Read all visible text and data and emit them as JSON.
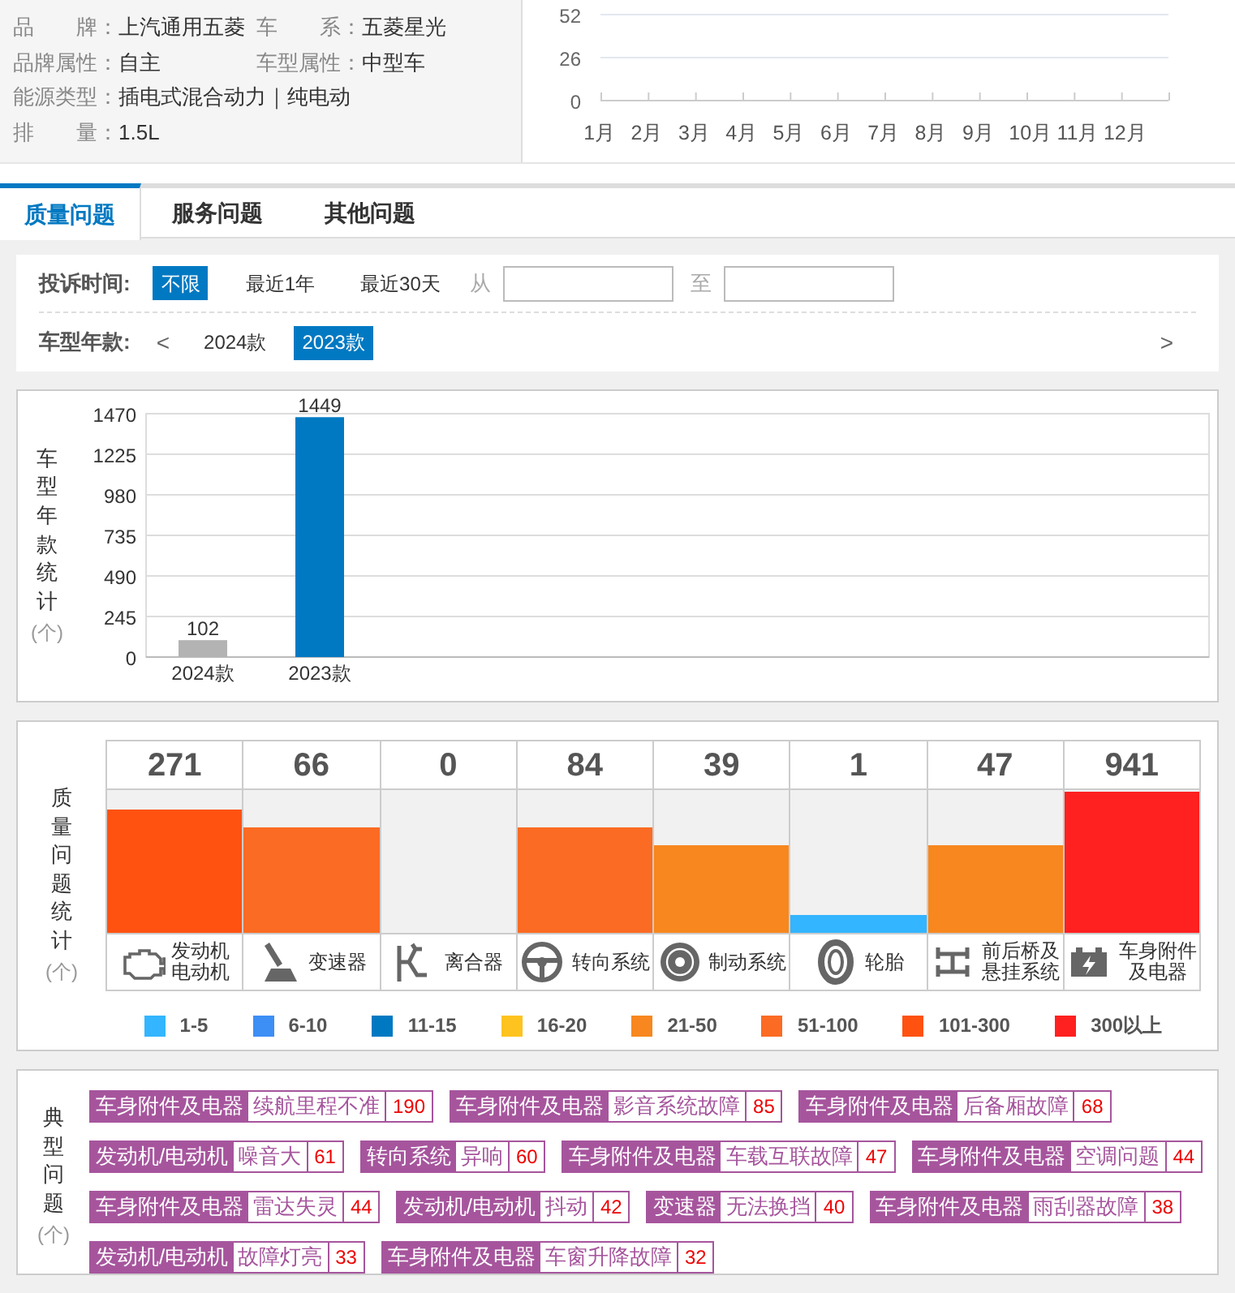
{
  "info": [
    [
      {
        "label": "品　　牌：",
        "value": "上汽通用五菱"
      },
      {
        "label": "车　　系：",
        "value": "五菱星光"
      }
    ],
    [
      {
        "label": "品牌属性：",
        "value": "自主"
      },
      {
        "label": "车型属性：",
        "value": "中型车"
      }
    ],
    [
      {
        "label": "能源类型：",
        "value": "插电式混合动力｜纯电动"
      }
    ],
    [
      {
        "label": "排　　量：",
        "value": "1.5L"
      }
    ]
  ],
  "trend_chart": {
    "chart_data": {
      "type": "line",
      "categories": [
        "1月",
        "2月",
        "3月",
        "4月",
        "5月",
        "6月",
        "7月",
        "8月",
        "9月",
        "10月",
        "11月",
        "12月"
      ],
      "ylim": [
        0,
        52
      ],
      "yticks": [
        0,
        26,
        52
      ]
    }
  },
  "tabs": [
    {
      "label": "质量问题",
      "selected": true
    },
    {
      "label": "服务问题",
      "selected": false
    },
    {
      "label": "其他问题",
      "selected": false
    }
  ],
  "filters": {
    "time_label": "投诉时间:",
    "time_options": [
      {
        "label": "不限",
        "selected": true
      },
      {
        "label": "最近1年",
        "selected": false
      },
      {
        "label": "最近30天",
        "selected": false
      }
    ],
    "from_label": "从",
    "to_label": "至",
    "year_label": "车型年款:",
    "prev": "<",
    "next": ">",
    "years": [
      {
        "label": "2024款",
        "selected": false
      },
      {
        "label": "2023款",
        "selected": true
      }
    ]
  },
  "year_chart": {
    "side_label": "车型年款统计",
    "unit": "(个)",
    "chart_data": {
      "type": "bar",
      "categories": [
        "2024款",
        "2023款"
      ],
      "series": [
        {
          "values": [
            102,
            1449
          ]
        }
      ],
      "ylim": [
        0,
        1470
      ],
      "grid": true,
      "yticks": [
        0,
        245,
        490,
        735,
        980,
        1225,
        1470
      ],
      "data_labels": true
    }
  },
  "quality": {
    "side_label": "质量问题统计",
    "unit": "(个)",
    "items": [
      {
        "count": "271",
        "label": "发动机电动机",
        "level": 0.875,
        "color": "#ff5211",
        "kind": "engine"
      },
      {
        "count": "66",
        "label": "变速器",
        "level": 0.75,
        "color": "#fb6b23",
        "kind": "gear"
      },
      {
        "count": "0",
        "label": "离合器",
        "kind": "clutch"
      },
      {
        "count": "84",
        "label": "转向系统",
        "level": 0.75,
        "color": "#fb6b23",
        "kind": "wheel"
      },
      {
        "count": "39",
        "label": "制动系统",
        "level": 0.625,
        "color": "#f7871e",
        "kind": "brake"
      },
      {
        "count": "1",
        "label": "轮胎",
        "level": 0.125,
        "color": "#33b5ff",
        "kind": "tire"
      },
      {
        "count": "47",
        "label": "前后桥及悬挂系统",
        "level": 0.625,
        "color": "#f7871e",
        "kind": "axle"
      },
      {
        "count": "941",
        "label": "车身附件及电器",
        "level": 1,
        "color": "#ff2020",
        "kind": "battery"
      }
    ],
    "legend": [
      {
        "label": "1-5",
        "color": "#33b5ff"
      },
      {
        "label": "6-10",
        "color": "#3d8ef5"
      },
      {
        "label": "11-15",
        "color": "#0079c2"
      },
      {
        "label": "16-20",
        "color": "#ffc31f"
      },
      {
        "label": "21-50",
        "color": "#f7871e"
      },
      {
        "label": "51-100",
        "color": "#fb6b23"
      },
      {
        "label": "101-300",
        "color": "#ff5211"
      },
      {
        "label": "300以上",
        "color": "#ff2020"
      }
    ]
  },
  "typical": {
    "side_label": "典型问题",
    "unit": "(个)",
    "tags": [
      {
        "category": "车身附件及电器",
        "issue": "续航里程不准",
        "count": "190"
      },
      {
        "category": "车身附件及电器",
        "issue": "影音系统故障",
        "count": "85"
      },
      {
        "category": "车身附件及电器",
        "issue": "后备厢故障",
        "count": "68"
      },
      {
        "category": "发动机/电动机",
        "issue": "噪音大",
        "count": "61"
      },
      {
        "category": "转向系统",
        "issue": "异响",
        "count": "60"
      },
      {
        "category": "车身附件及电器",
        "issue": "车载互联故障",
        "count": "47"
      },
      {
        "category": "车身附件及电器",
        "issue": "空调问题",
        "count": "44"
      },
      {
        "category": "车身附件及电器",
        "issue": "雷达失灵",
        "count": "44"
      },
      {
        "category": "发动机/电动机",
        "issue": "抖动",
        "count": "42"
      },
      {
        "category": "变速器",
        "issue": "无法换挡",
        "count": "40"
      },
      {
        "category": "车身附件及电器",
        "issue": "雨刮器故障",
        "count": "38"
      },
      {
        "category": "发动机/电动机",
        "issue": "故障灯亮",
        "count": "33"
      },
      {
        "category": "车身附件及电器",
        "issue": "车窗升降故障",
        "count": "32"
      }
    ]
  }
}
